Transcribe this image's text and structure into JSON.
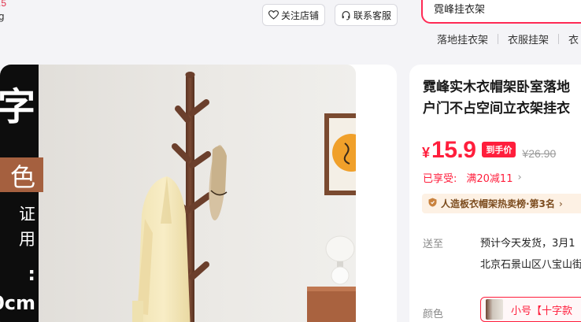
{
  "corner": {
    "price_fragment": ".5",
    "mark": "g"
  },
  "header": {
    "follow_label": "关注店铺",
    "service_label": "联系客服",
    "search": {
      "value": "霓峰挂衣架"
    },
    "hot_words": [
      "落地挂衣架",
      "衣服挂架",
      "衣"
    ]
  },
  "gallery": {
    "band_lines": [
      "字",
      "色",
      "证",
      "用",
      ":",
      "0cm"
    ]
  },
  "product": {
    "title_line1": "霓峰实木衣帽架卧室落地",
    "title_line2": "户门不占空间立衣架挂衣",
    "price": {
      "currency": "¥",
      "value": "15.9",
      "badge": "到手价",
      "original": "¥26.90"
    },
    "promo": {
      "label": "已享受:",
      "value": "满20减11",
      "chevron": "›"
    },
    "rank": "人造板衣帽架热卖榜·第3名",
    "shipping": {
      "label": "送至",
      "line1": "预计今天发货，3月1",
      "line2": "北京石景山区八宝山街"
    },
    "color": {
      "label": "颜色",
      "selected": "小号【十字款"
    }
  },
  "colors": {
    "accent": "#ff1e3c",
    "search_border": "#ff2a55",
    "rank_bg": "#fdf1e4",
    "rank_text": "#7c4c1e",
    "band_accent": "#a5603f"
  }
}
